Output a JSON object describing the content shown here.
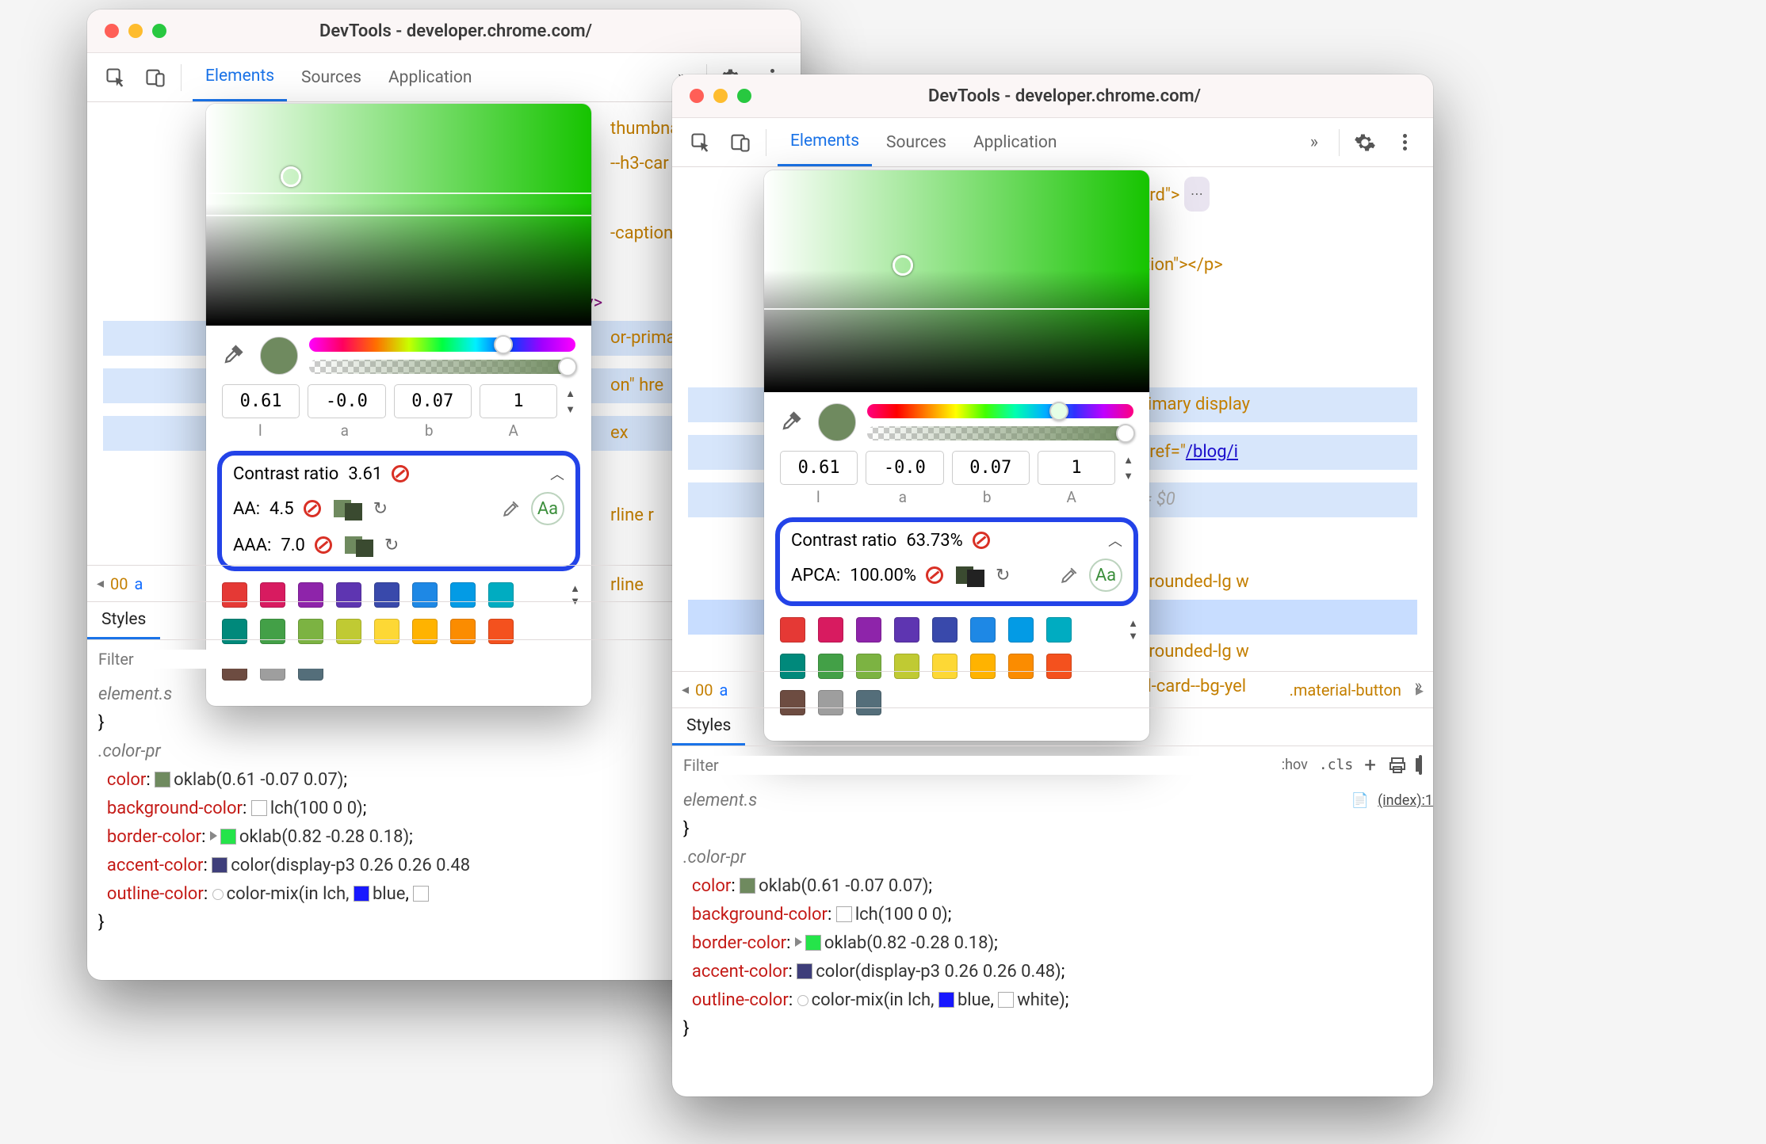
{
  "window_title": "DevTools - developer.chrome.com/",
  "tabs": [
    "Elements",
    "Sources",
    "Application"
  ],
  "active_tab": "Elements",
  "dom_fragments": {
    "thumbnail": "thumbna",
    "h3card_short": "--h3-car",
    "h3card_full": "--h3-card\"> ",
    "caption_short": "-caption",
    "caption_full": "-caption\"></p>",
    "divclose": "</div>",
    "primary_short": "or-prima",
    "primary_full": "or-primary display",
    "on_href_short": "on\" hre",
    "on_href_full": "on\" href=\"",
    "href_link": "/blog/i",
    "ex_short": "ex",
    "ex_eq0": " == $0",
    "rline_short": "rline r",
    "rline_full": "rline rounded-lg w",
    "sel_material_short": ".materia",
    "sel_material_full": ".material-button",
    "tured_card": "tured-card--bg-yel"
  },
  "breadcrumb": {
    "tag": "00",
    "class": "a"
  },
  "subtab": "Styles",
  "filter_placeholder": "Filter",
  "filter_labels": {
    "hov": ":hov",
    "cls": ".cls"
  },
  "css": {
    "rule_header": "element.s",
    "selector": ".color-pr",
    "color_val": "oklab(0.61 -0.07 0.07)",
    "bg_val": "lch(100 0 0)",
    "border_val": "oklab(0.82 -0.28 0.18)",
    "accent_val": "color(display-p3 0.26 0.26 0.48",
    "accent_val_full": "color(display-p3 0.26 0.26 0.48)",
    "outline_lead": "color-mix(in lch,",
    "outline_blue": "blue",
    "outline_white_sq": "□",
    "outline_white": "white)",
    "props": {
      "color": "color",
      "bg": "background-color",
      "border": "border-color",
      "accent": "accent-color",
      "outline": "outline-color"
    }
  },
  "picker": {
    "l": "0.61",
    "a": "-0.0",
    "b": "0.07",
    "alpha": "1",
    "labels": {
      "l": "l",
      "a": "a",
      "b": "b",
      "A": "A"
    },
    "swatch": "#6f8a5f"
  },
  "contrast_left": {
    "title": "Contrast ratio",
    "value": "3.61",
    "aa_label": "AA:",
    "aa_val": "4.5",
    "aaa_label": "AAA:",
    "aaa_val": "7.0"
  },
  "contrast_right": {
    "title": "Contrast ratio",
    "value": "63.73%",
    "apca_label": "APCA:",
    "apca_val": "100.00%"
  },
  "palette": [
    [
      "#e53935",
      "#d81b60",
      "#8e24aa",
      "#5e35b1",
      "#3949ab",
      "#1e88e5",
      "#039be5",
      "#00acc1"
    ],
    [
      "#00897b",
      "#43a047",
      "#7cb342",
      "#c0ca33",
      "#fdd835",
      "#ffb300",
      "#fb8c00",
      "#f4511e"
    ],
    [
      "#6d4c41",
      "#9e9e9e",
      "#546e7a"
    ]
  ],
  "src_badge": "(index):1",
  "aa_glyph": "Aa"
}
